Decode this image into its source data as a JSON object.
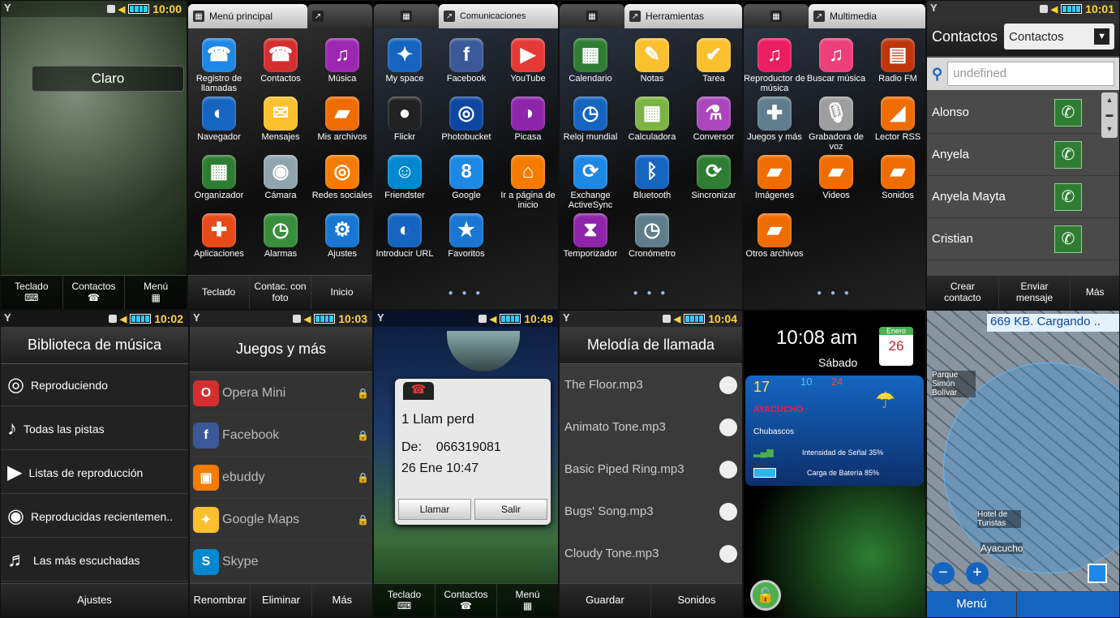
{
  "s1": {
    "time": "10:00",
    "carrier": "Claro",
    "bottom": [
      {
        "label": "Teclado",
        "icon": "⌨"
      },
      {
        "label": "Contactos",
        "icon": "☎"
      },
      {
        "label": "Menú",
        "icon": "▦"
      }
    ]
  },
  "s2": {
    "tab": "Menú principal",
    "icons": [
      {
        "l": "Registro de llamadas",
        "c": "#1e88e5",
        "g": "☎"
      },
      {
        "l": "Contactos",
        "c": "#d32f2f",
        "g": "☎"
      },
      {
        "l": "Música",
        "c": "#9c27b0",
        "g": "♫"
      },
      {
        "l": "Navegador",
        "c": "#1565c0",
        "g": "◐"
      },
      {
        "l": "Mensajes",
        "c": "#fbc02d",
        "g": "✉"
      },
      {
        "l": "Mis archivos",
        "c": "#ef6c00",
        "g": "▰"
      },
      {
        "l": "Organizador",
        "c": "#2e7d32",
        "g": "▦"
      },
      {
        "l": "Cámara",
        "c": "#90a4ae",
        "g": "◉"
      },
      {
        "l": "Redes sociales",
        "c": "#f57c00",
        "g": "◎"
      },
      {
        "l": "Aplicaciones",
        "c": "#e64a19",
        "g": "✚"
      },
      {
        "l": "Alarmas",
        "c": "#388e3c",
        "g": "◷"
      },
      {
        "l": "Ajustes",
        "c": "#1976d2",
        "g": "⚙"
      }
    ],
    "bottom": [
      "Teclado",
      "Contac. con foto",
      "Inicio"
    ]
  },
  "s3": {
    "tab": "Comunicaciones",
    "icons": [
      {
        "l": "My space",
        "c": "#1565c0",
        "g": "✦"
      },
      {
        "l": "Facebook",
        "c": "#3b5998",
        "g": "f"
      },
      {
        "l": "YouTube",
        "c": "#e53935",
        "g": "▶"
      },
      {
        "l": "Flickr",
        "c": "#222",
        "g": "●"
      },
      {
        "l": "Photobucket",
        "c": "#0d47a1",
        "g": "◎"
      },
      {
        "l": "Picasa",
        "c": "#8e24aa",
        "g": "◑"
      },
      {
        "l": "Friendster",
        "c": "#0288d1",
        "g": "☺"
      },
      {
        "l": "Google",
        "c": "#1e88e5",
        "g": "8"
      },
      {
        "l": "Ir a página de inicio",
        "c": "#f57c00",
        "g": "⌂"
      },
      {
        "l": "Introducir URL",
        "c": "#1565c0",
        "g": "◐"
      },
      {
        "l": "Favoritos",
        "c": "#1976d2",
        "g": "★"
      }
    ]
  },
  "s4": {
    "tab": "Herramientas",
    "icons": [
      {
        "l": "Calendario",
        "c": "#2e7d32",
        "g": "▦"
      },
      {
        "l": "Notas",
        "c": "#fbc02d",
        "g": "✎"
      },
      {
        "l": "Tarea",
        "c": "#fbc02d",
        "g": "✔"
      },
      {
        "l": "Reloj mundial",
        "c": "#1565c0",
        "g": "◷"
      },
      {
        "l": "Calculadora",
        "c": "#7cb342",
        "g": "▦"
      },
      {
        "l": "Conversor",
        "c": "#ab47bc",
        "g": "⚗"
      },
      {
        "l": "Exchange ActiveSync",
        "c": "#1e88e5",
        "g": "⟳"
      },
      {
        "l": "Bluetooth",
        "c": "#1565c0",
        "g": "ᛒ"
      },
      {
        "l": "Sincronizar",
        "c": "#2e7d32",
        "g": "⟳"
      },
      {
        "l": "Temporizador",
        "c": "#8e24aa",
        "g": "⧗"
      },
      {
        "l": "Cronómetro",
        "c": "#607d8b",
        "g": "◷"
      }
    ]
  },
  "s5": {
    "tab": "Multimedia",
    "icons": [
      {
        "l": "Reproductor de música",
        "c": "#e91e63",
        "g": "♫"
      },
      {
        "l": "Buscar música",
        "c": "#ec407a",
        "g": "♫"
      },
      {
        "l": "Radio FM",
        "c": "#bf360c",
        "g": "▤"
      },
      {
        "l": "Juegos y más",
        "c": "#607d8b",
        "g": "✚"
      },
      {
        "l": "Grabadora de voz",
        "c": "#9e9e9e",
        "g": "🎙"
      },
      {
        "l": "Lector RSS",
        "c": "#ef6c00",
        "g": "◢"
      },
      {
        "l": "Imágenes",
        "c": "#ef6c00",
        "g": "▰"
      },
      {
        "l": "Videos",
        "c": "#ef6c00",
        "g": "▰"
      },
      {
        "l": "Sonidos",
        "c": "#ef6c00",
        "g": "▰"
      },
      {
        "l": "Otros archivos",
        "c": "#ef6c00",
        "g": "▰"
      }
    ]
  },
  "s6": {
    "time": "10:01",
    "title": "Contactos",
    "filter": "Contactos",
    "search": "undefined",
    "contacts": [
      "Alonso",
      "Anyela",
      "Anyela Mayta",
      "Cristian"
    ],
    "bottom": [
      "Crear contacto",
      "Enviar mensaje",
      "Más"
    ]
  },
  "s7": {
    "time": "10:02",
    "title": "Biblioteca de música",
    "items": [
      "Reproduciendo",
      "Todas las pistas",
      "Listas de reproducción",
      "Reproducidas recientemen..",
      "Las más escuchadas"
    ],
    "bottom": "Ajustes"
  },
  "s8": {
    "time": "10:03",
    "title": "Juegos y más",
    "items": [
      {
        "l": "Opera Mini",
        "c": "#d32f2f",
        "g": "O"
      },
      {
        "l": "Facebook",
        "c": "#3b5998",
        "g": "f"
      },
      {
        "l": "ebuddy",
        "c": "#f57c00",
        "g": "▣"
      },
      {
        "l": "Google Maps",
        "c": "#fbc02d",
        "g": "✦"
      },
      {
        "l": "Skype",
        "c": "#0288d1",
        "g": "S"
      }
    ],
    "bottom": [
      "Renombrar",
      "Eliminar",
      "Más"
    ]
  },
  "s9": {
    "time": "10:49",
    "dlg_title": "1 Llam perd",
    "from_label": "De:",
    "number": "066319081",
    "date": "26 Ene 10:47",
    "btn_call": "Llamar",
    "btn_exit": "Salir",
    "bottom": [
      {
        "label": "Teclado",
        "icon": "⌨"
      },
      {
        "label": "Contactos",
        "icon": "☎"
      },
      {
        "label": "Menú",
        "icon": "▦"
      }
    ]
  },
  "s10": {
    "time": "10:04",
    "title": "Melodía de llamada",
    "items": [
      "The Floor.mp3",
      "Animato Tone.mp3",
      "Basic Piped Ring.mp3",
      "Bugs' Song.mp3",
      "Cloudy Tone.mp3"
    ],
    "bottom": [
      "Guardar",
      "Sonidos"
    ]
  },
  "s11": {
    "clock": "10:08 am",
    "day": "Sábado",
    "cal_month": "Enero",
    "cal_day": "26",
    "temp": "17",
    "tmin": "10",
    "tmax": "24",
    "city": "AYACUCHO",
    "weather": "Chubascos",
    "signal": "Intensidad de Señal 35%",
    "battery": "Carga de Batería 85%"
  },
  "s12": {
    "banner": "669 KB.  Cargando ..",
    "labels": [
      "Parque Simón Bolívar",
      "Hotel de Turistas",
      "Ayacucho"
    ],
    "bottom": "Menú"
  }
}
